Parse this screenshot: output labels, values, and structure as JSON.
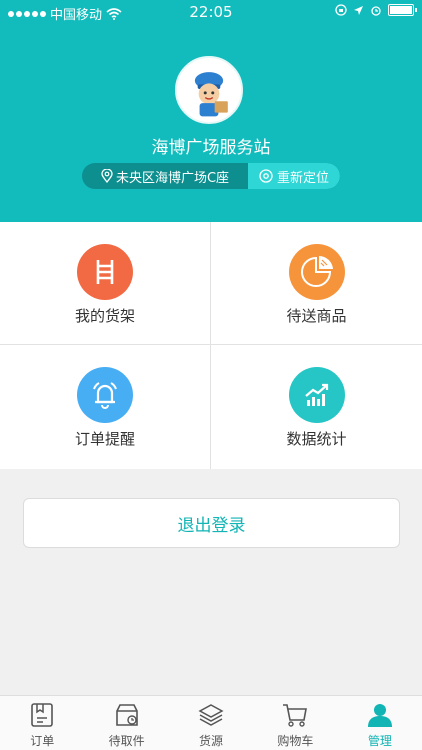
{
  "status_bar": {
    "carrier": "中国移动",
    "time": "22:05"
  },
  "profile": {
    "station_name": "海博广场服务站",
    "address": "未央区海博广场C座",
    "relocate_label": "重新定位"
  },
  "menu": [
    {
      "label": "我的货架",
      "icon": "shelf-icon",
      "color": "#f26a44"
    },
    {
      "label": "待送商品",
      "icon": "pie-chart-icon",
      "color": "#f6943c"
    },
    {
      "label": "订单提醒",
      "icon": "bell-icon",
      "color": "#48aef4"
    },
    {
      "label": "数据统计",
      "icon": "trend-chart-icon",
      "color": "#26c6c6"
    }
  ],
  "logout_label": "退出登录",
  "tabs": [
    {
      "label": "订单",
      "icon": "order-icon",
      "active": false
    },
    {
      "label": "待取件",
      "icon": "pickup-box-icon",
      "active": false
    },
    {
      "label": "货源",
      "icon": "layers-icon",
      "active": false
    },
    {
      "label": "购物车",
      "icon": "cart-icon",
      "active": false
    },
    {
      "label": "管理",
      "icon": "user-icon",
      "active": true
    }
  ],
  "colors": {
    "brand": "#12bcbc",
    "accent_text": "#12b4b4"
  }
}
